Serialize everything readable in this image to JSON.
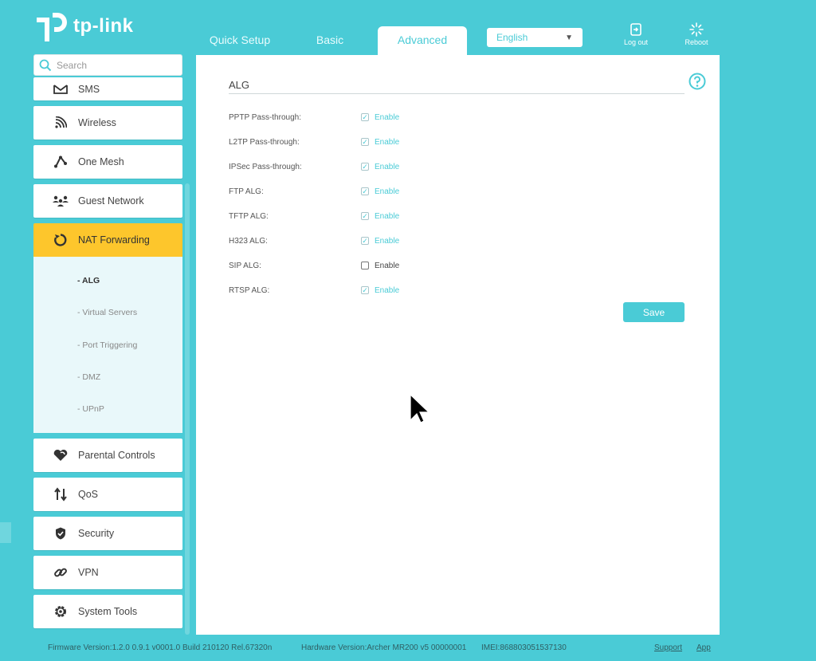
{
  "brand": {
    "logo_text": "tp-link"
  },
  "tabs": [
    {
      "label": "Quick Setup"
    },
    {
      "label": "Basic"
    },
    {
      "label": "Advanced"
    }
  ],
  "language": {
    "selected": "English"
  },
  "header_buttons": {
    "logout": "Log out",
    "reboot": "Reboot"
  },
  "search": {
    "placeholder": "Search"
  },
  "sidebar": {
    "items": [
      {
        "label": "SMS",
        "icon": "sms-icon"
      },
      {
        "label": "Wireless",
        "icon": "wifi-icon"
      },
      {
        "label": "One Mesh",
        "icon": "mesh-icon"
      },
      {
        "label": "Guest Network",
        "icon": "guest-network-icon"
      },
      {
        "label": "NAT Forwarding",
        "icon": "nat-forwarding-icon",
        "active": true
      },
      {
        "label": "Parental Controls",
        "icon": "heart-icon"
      },
      {
        "label": "QoS",
        "icon": "qos-arrows-icon"
      },
      {
        "label": "Security",
        "icon": "shield-icon"
      },
      {
        "label": "VPN",
        "icon": "link-icon"
      },
      {
        "label": "System Tools",
        "icon": "gear-icon"
      }
    ],
    "submenu": [
      {
        "label": "- ALG",
        "active": true
      },
      {
        "label": "- Virtual Servers"
      },
      {
        "label": "- Port Triggering"
      },
      {
        "label": "- DMZ"
      },
      {
        "label": "- UPnP"
      }
    ]
  },
  "page": {
    "title": "ALG",
    "rows": [
      {
        "label": "PPTP Pass-through:",
        "enabled": true,
        "option": "Enable"
      },
      {
        "label": "L2TP Pass-through:",
        "enabled": true,
        "option": "Enable"
      },
      {
        "label": "IPSec Pass-through:",
        "enabled": true,
        "option": "Enable"
      },
      {
        "label": "FTP ALG:",
        "enabled": true,
        "option": "Enable"
      },
      {
        "label": "TFTP ALG:",
        "enabled": true,
        "option": "Enable"
      },
      {
        "label": "H323 ALG:",
        "enabled": true,
        "option": "Enable"
      },
      {
        "label": "SIP ALG:",
        "enabled": false,
        "option": "Enable"
      },
      {
        "label": "RTSP ALG:",
        "enabled": true,
        "option": "Enable"
      }
    ],
    "save_label": "Save"
  },
  "footer": {
    "firmware": "Firmware Version:1.2.0 0.9.1 v0001.0 Build 210120 Rel.67320n",
    "hardware": "Hardware Version:Archer MR200 v5 00000001",
    "imei": "IMEI:868803051537130",
    "support": "Support",
    "app": "App"
  },
  "colors": {
    "accent": "#4acbd6",
    "active_menu": "#fdc62c",
    "submenu_bg": "#e9f8fa"
  }
}
